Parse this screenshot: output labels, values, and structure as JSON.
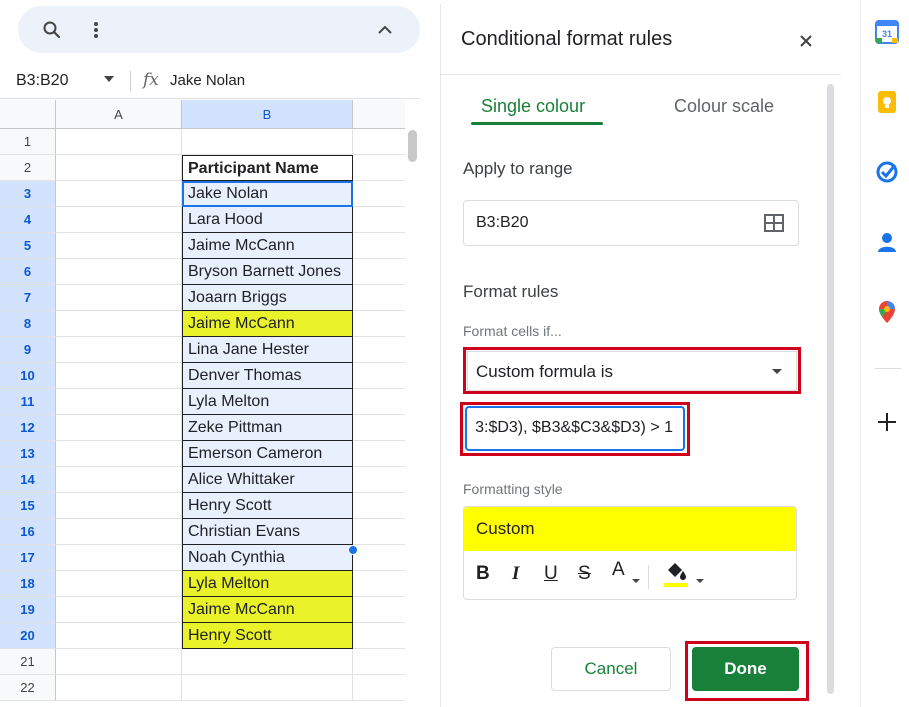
{
  "toolbar": {
    "search_icon": "search-icon",
    "more_icon": "more-vert-icon",
    "collapse_icon": "chevron-up-icon"
  },
  "formula_bar": {
    "name_box": "B3:B20",
    "fx_label": "fx",
    "value": "Jake Nolan"
  },
  "sheet": {
    "columns": [
      "A",
      "B"
    ],
    "rows": [
      {
        "num": "1",
        "b": "",
        "style": "plain"
      },
      {
        "num": "2",
        "b": "Participant Name",
        "style": "header"
      },
      {
        "num": "3",
        "b": "Jake Nolan",
        "style": "range"
      },
      {
        "num": "4",
        "b": "Lara Hood",
        "style": "range"
      },
      {
        "num": "5",
        "b": "Jaime McCann",
        "style": "range"
      },
      {
        "num": "6",
        "b": "Bryson Barnett Jones",
        "style": "range"
      },
      {
        "num": "7",
        "b": "Joaarn Briggs",
        "style": "range"
      },
      {
        "num": "8",
        "b": "Jaime McCann",
        "style": "highlight"
      },
      {
        "num": "9",
        "b": "Lina Jane Hester",
        "style": "range"
      },
      {
        "num": "10",
        "b": "Denver Thomas",
        "style": "range"
      },
      {
        "num": "11",
        "b": "Lyla Melton",
        "style": "range"
      },
      {
        "num": "12",
        "b": "Zeke Pittman",
        "style": "range"
      },
      {
        "num": "13",
        "b": "Emerson Cameron",
        "style": "range"
      },
      {
        "num": "14",
        "b": "Alice Whittaker",
        "style": "range"
      },
      {
        "num": "15",
        "b": "Henry Scott",
        "style": "range"
      },
      {
        "num": "16",
        "b": "Christian Evans",
        "style": "range"
      },
      {
        "num": "17",
        "b": "Noah Cynthia",
        "style": "range"
      },
      {
        "num": "18",
        "b": "Lyla Melton",
        "style": "highlight"
      },
      {
        "num": "19",
        "b": "Jaime McCann",
        "style": "highlight"
      },
      {
        "num": "20",
        "b": "Henry Scott",
        "style": "highlight"
      },
      {
        "num": "21",
        "b": "",
        "style": "plain"
      },
      {
        "num": "22",
        "b": "",
        "style": "plain"
      }
    ]
  },
  "panel": {
    "title": "Conditional format rules",
    "tabs": {
      "single": "Single colour",
      "scale": "Colour scale"
    },
    "apply_label": "Apply to range",
    "range_value": "B3:B20",
    "format_rules_label": "Format rules",
    "format_cells_if_label": "Format cells if...",
    "condition_value": "Custom formula is",
    "formula_value": "3:$D3), $B3&$C3&$D3) > 1",
    "formatting_style_label": "Formatting style",
    "style_preview_label": "Custom",
    "style_tools": {
      "bold": "B",
      "italic": "I",
      "underline": "U",
      "strikethrough": "S",
      "text_color": "A"
    },
    "cancel_label": "Cancel",
    "done_label": "Done"
  },
  "colors": {
    "accent_green": "#188038",
    "highlight_yellow": "#eaf22a",
    "annotation_red": "#d0021b",
    "selection_blue": "#1a73e8"
  },
  "side_apps": [
    "calendar-icon",
    "keep-icon",
    "tasks-icon",
    "contacts-icon",
    "maps-icon",
    "add-icon"
  ]
}
